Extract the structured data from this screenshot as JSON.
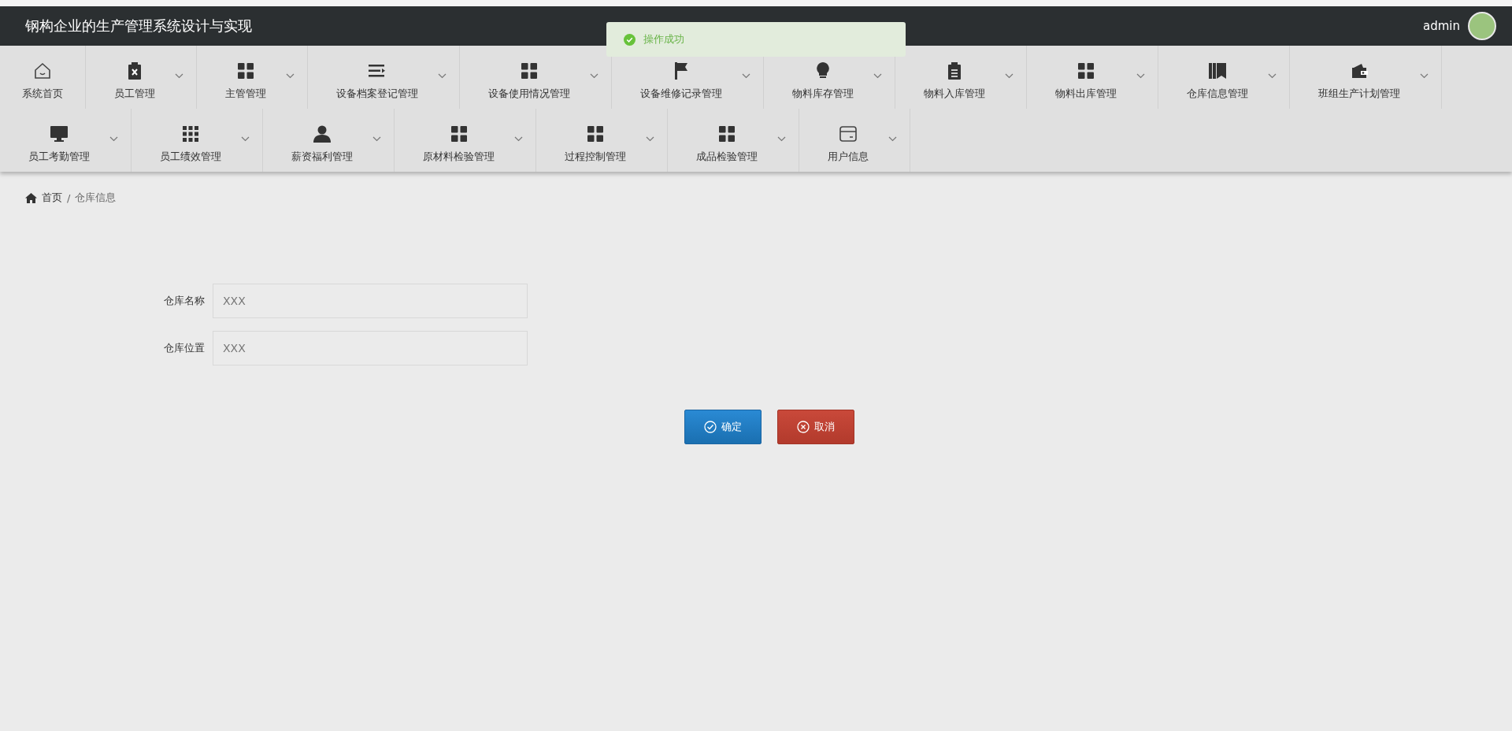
{
  "header": {
    "title": "钢构企业的生产管理系统设计与实现",
    "user": "admin"
  },
  "toast": {
    "message": "操作成功"
  },
  "nav": [
    {
      "label": "系统首页",
      "has_dropdown": false
    },
    {
      "label": "员工管理",
      "has_dropdown": true
    },
    {
      "label": "主管管理",
      "has_dropdown": true
    },
    {
      "label": "设备档案登记管理",
      "has_dropdown": true
    },
    {
      "label": "设备使用情况管理",
      "has_dropdown": true
    },
    {
      "label": "设备维修记录管理",
      "has_dropdown": true
    },
    {
      "label": "物料库存管理",
      "has_dropdown": true
    },
    {
      "label": "物料入库管理",
      "has_dropdown": true
    },
    {
      "label": "物料出库管理",
      "has_dropdown": true
    },
    {
      "label": "仓库信息管理",
      "has_dropdown": true
    },
    {
      "label": "班组生产计划管理",
      "has_dropdown": true
    },
    {
      "label": "员工考勤管理",
      "has_dropdown": true
    },
    {
      "label": "员工绩效管理",
      "has_dropdown": true
    },
    {
      "label": "薪资福利管理",
      "has_dropdown": true
    },
    {
      "label": "原材料检验管理",
      "has_dropdown": true
    },
    {
      "label": "过程控制管理",
      "has_dropdown": true
    },
    {
      "label": "成品检验管理",
      "has_dropdown": true
    },
    {
      "label": "用户信息",
      "has_dropdown": true
    }
  ],
  "breadcrumb": {
    "items": [
      "首页",
      "仓库信息"
    ],
    "separator": "/"
  },
  "form": {
    "fields": [
      {
        "label": "仓库名称",
        "value": "XXX"
      },
      {
        "label": "仓库位置",
        "value": "XXX"
      }
    ],
    "buttons": [
      {
        "kind": "confirm",
        "label": "确定"
      },
      {
        "kind": "cancel",
        "label": "取消"
      }
    ]
  }
}
